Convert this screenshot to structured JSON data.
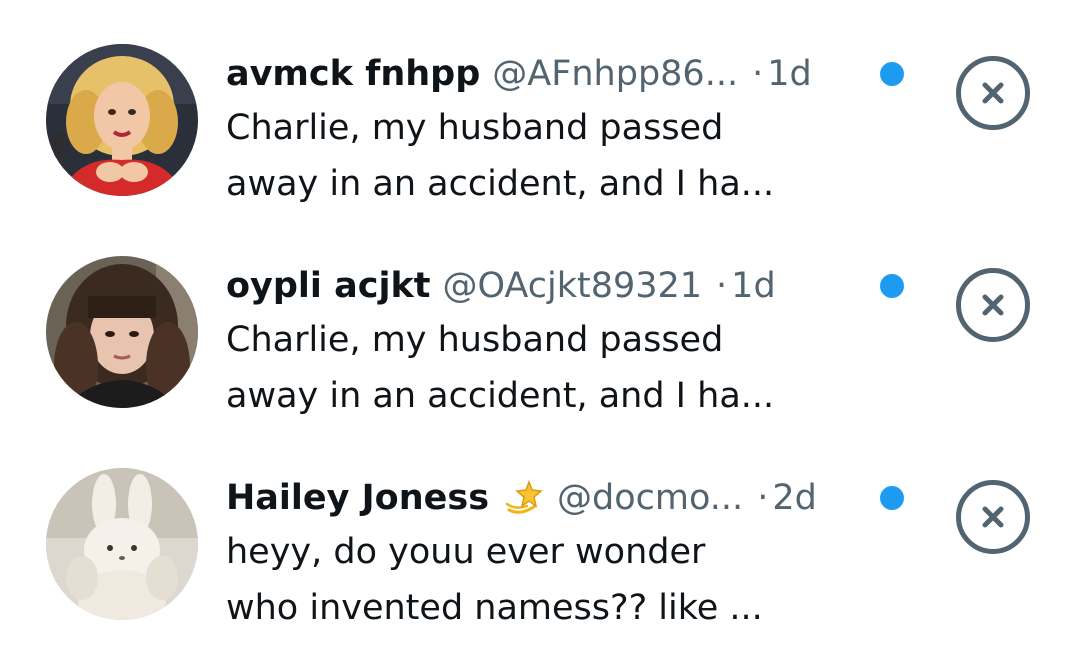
{
  "notifications": [
    {
      "name": "avmck fnhpp",
      "handle": "@AFnhpp86...",
      "separator": "·",
      "time": "1d",
      "line1": "Charlie, my husband passed",
      "line2": "away in an accident, and I ha...",
      "avatar_icon": "avatar-illustrated-woman-red-dress",
      "unread": true
    },
    {
      "name": "oypli acjkt",
      "handle": "@OAcjkt89321",
      "separator": "·",
      "time": "1d",
      "line1": "Charlie, my husband passed",
      "line2": "away in an accident, and I ha...",
      "avatar_icon": "avatar-photo-woman-brown-hair",
      "unread": true
    },
    {
      "name": "Hailey Joness",
      "handle": "@docmo...",
      "separator": "·",
      "time": "2d",
      "line1": "heyy, do youu ever wonder",
      "line2": "who invented namess?? like ...",
      "avatar_icon": "avatar-plush-bunny",
      "badge_icon": "dizzy-star-emoji",
      "unread": true
    }
  ],
  "colors": {
    "text_primary": "#0f1419",
    "text_secondary": "#536471",
    "unread_dot": "#1d9bf0",
    "background": "#ffffff"
  },
  "icons": {
    "dismiss": "close-circle-icon",
    "unread": "unread-dot-icon"
  }
}
